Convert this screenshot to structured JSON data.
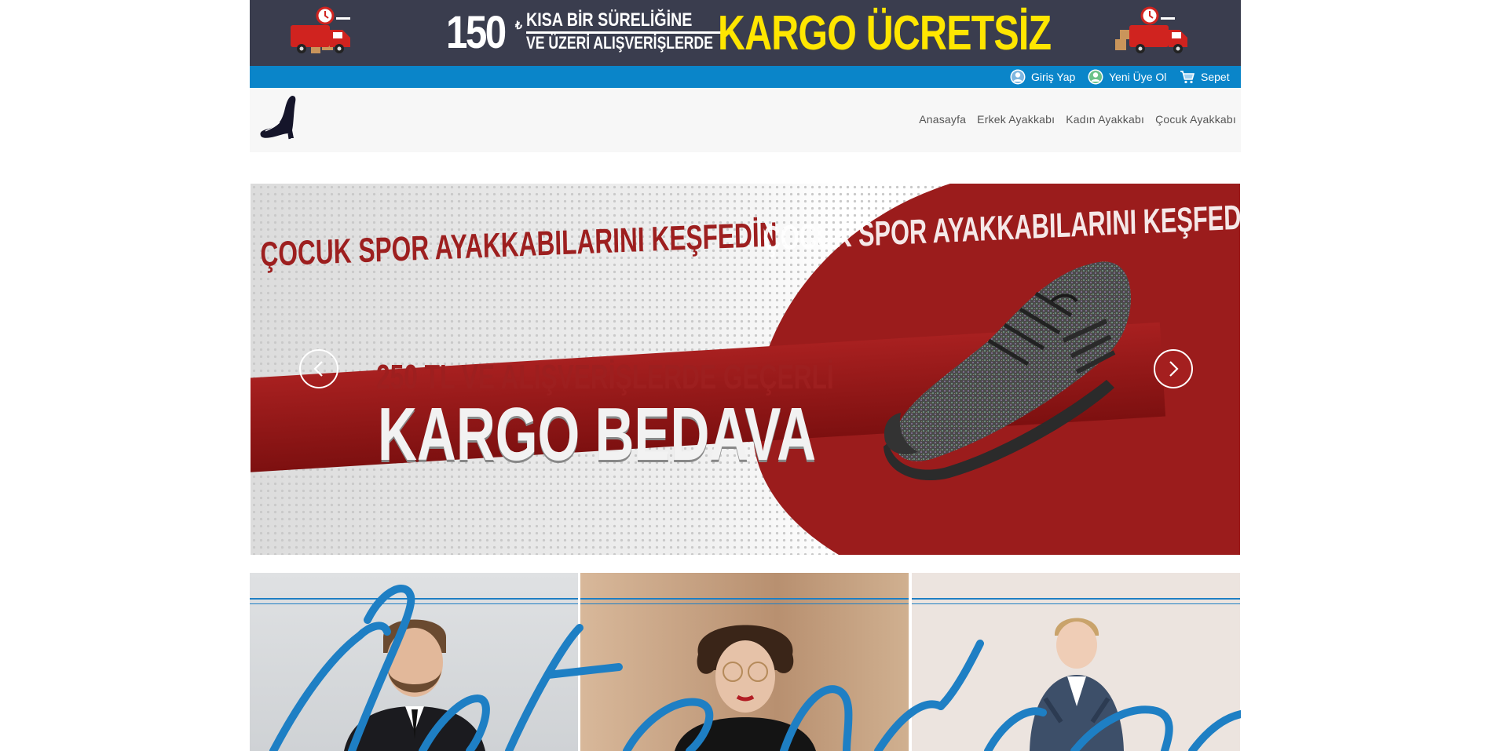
{
  "promo": {
    "amount": "150",
    "currency": "₺",
    "line1": "KISA BİR SÜRELİĞİNE",
    "line2": "VE ÜZERİ ALIŞVERİŞLERDE",
    "highlight": "KARGO ÜCRETSİZ"
  },
  "account": {
    "login": "Giriş Yap",
    "register": "Yeni Üye Ol",
    "cart": "Sepet"
  },
  "nav": {
    "items": [
      "Anasayfa",
      "Erkek Ayakkabı",
      "Kadın Ayakkabı",
      "Çocuk Ayakkabı"
    ]
  },
  "hero": {
    "headline": "ÇOCUK SPOR AYAKKABILARINI KEŞFEDİN",
    "headline_repeat": "ÇOCUK SPOR AYAKKABILARINI KEŞFEDİN",
    "subline": "250 TL VE ALIŞVERİŞLERDE GEÇERLİ",
    "big": "KARGO BEDAVA"
  },
  "colors": {
    "promo_bg": "#3a3d4e",
    "account_bar": "#0a85c9",
    "promo_highlight": "#ffe600",
    "hero_red": "#9b1c1c",
    "script_blue": "#1e7fc4"
  },
  "icons": {
    "login": "user-icon",
    "register": "user-add-icon",
    "cart": "cart-icon",
    "prev": "chevron-left-icon",
    "next": "chevron-right-icon"
  }
}
